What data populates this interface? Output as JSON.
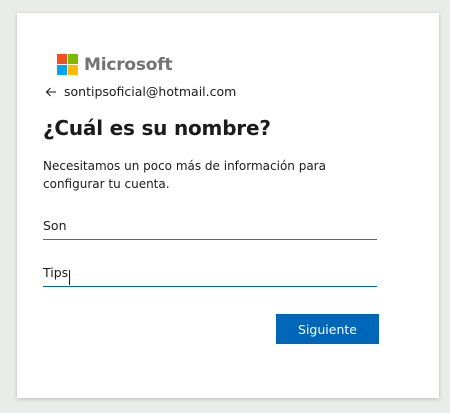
{
  "brand": {
    "name": "Microsoft",
    "logo_colors": [
      "#f25022",
      "#7fba00",
      "#00a4ef",
      "#ffb900"
    ]
  },
  "identity": {
    "email": "sontipsoficial@hotmail.com",
    "back_icon": "arrow-left-icon"
  },
  "form": {
    "title": "¿Cuál es su nombre?",
    "description": "Necesitamos un poco más de información para configurar tu cuenta.",
    "first_name": {
      "value": "Son"
    },
    "last_name": {
      "value": "Tips"
    },
    "next_label": "Siguiente"
  },
  "colors": {
    "accent": "#0067b8",
    "background": "#e9edea",
    "card": "#ffffff"
  }
}
